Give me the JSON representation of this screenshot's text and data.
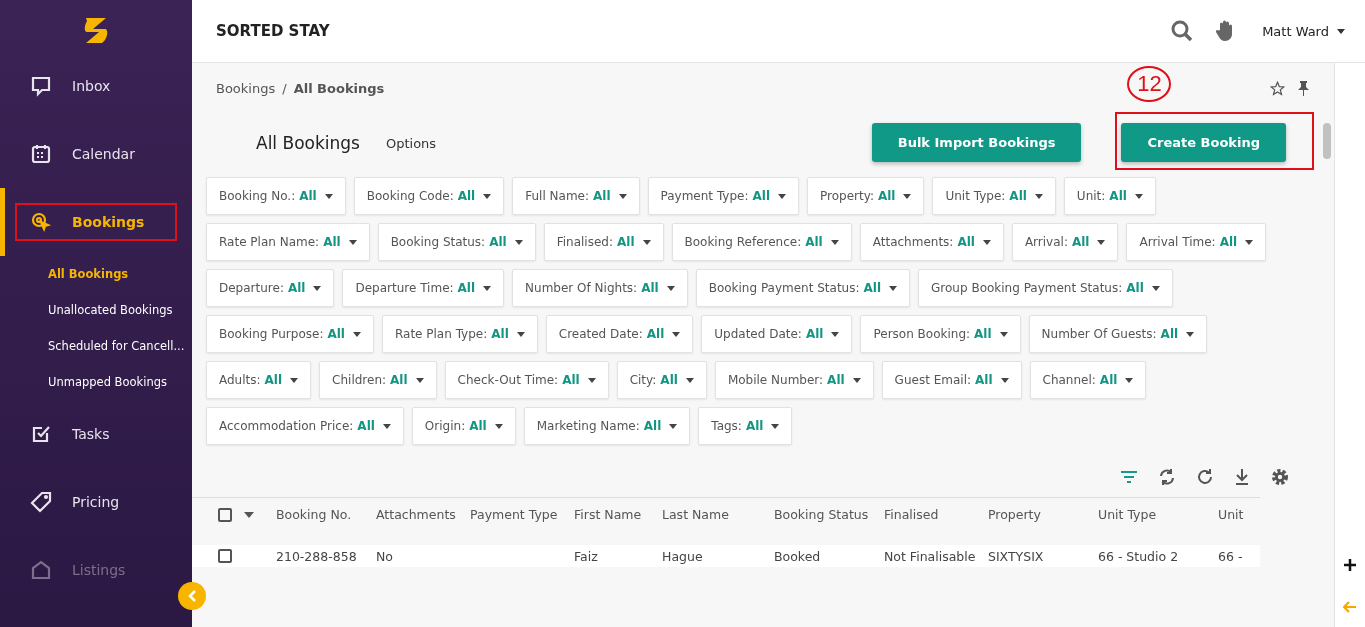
{
  "sidebar": {
    "items": [
      {
        "label": "Inbox",
        "kind": "inbox",
        "selected": false,
        "disabled": false,
        "highlighted": false
      },
      {
        "label": "Calendar",
        "kind": "calendar",
        "selected": false,
        "disabled": false,
        "highlighted": false
      },
      {
        "label": "Bookings",
        "kind": "bookings",
        "selected": true,
        "disabled": false,
        "highlighted": true,
        "children": [
          {
            "label": "All Bookings",
            "selected": true
          },
          {
            "label": "Unallocated Bookings",
            "selected": false
          },
          {
            "label": "Scheduled for Cancell...",
            "selected": false
          },
          {
            "label": "Unmapped Bookings",
            "selected": false
          }
        ]
      },
      {
        "label": "Tasks",
        "kind": "tasks",
        "selected": false,
        "disabled": false,
        "highlighted": false
      },
      {
        "label": "Pricing",
        "kind": "pricing",
        "selected": false,
        "disabled": false,
        "highlighted": false
      },
      {
        "label": "Listings",
        "kind": "listings",
        "selected": false,
        "disabled": true,
        "highlighted": false
      }
    ]
  },
  "header": {
    "title": "SORTED STAY",
    "user": "Matt Ward"
  },
  "breadcrumb": {
    "separator": "/",
    "items": [
      "Bookings",
      "All Bookings"
    ]
  },
  "page": {
    "title": "All Bookings",
    "options": "Options",
    "annotation": "12",
    "buttons": [
      {
        "label": "Bulk Import Bookings",
        "highlighted": false
      },
      {
        "label": "Create Booking",
        "highlighted": true
      }
    ]
  },
  "filters": [
    {
      "label": "Booking No.:",
      "value": "All"
    },
    {
      "label": "Booking Code:",
      "value": "All"
    },
    {
      "label": "Full Name:",
      "value": "All"
    },
    {
      "label": "Payment Type:",
      "value": "All"
    },
    {
      "label": "Property:",
      "value": "All"
    },
    {
      "label": "Unit Type:",
      "value": "All"
    },
    {
      "label": "Unit:",
      "value": "All"
    },
    {
      "label": "Rate Plan Name:",
      "value": "All"
    },
    {
      "label": "Booking Status:",
      "value": "All"
    },
    {
      "label": "Finalised:",
      "value": "All"
    },
    {
      "label": "Booking Reference:",
      "value": "All"
    },
    {
      "label": "Attachments:",
      "value": "All"
    },
    {
      "label": "Arrival:",
      "value": "All"
    },
    {
      "label": "Arrival Time:",
      "value": "All"
    },
    {
      "label": "Departure:",
      "value": "All"
    },
    {
      "label": "Departure Time:",
      "value": "All"
    },
    {
      "label": "Number Of Nights:",
      "value": "All"
    },
    {
      "label": "Booking Payment Status:",
      "value": "All"
    },
    {
      "label": "Group Booking Payment Status:",
      "value": "All"
    },
    {
      "label": "Booking Purpose:",
      "value": "All"
    },
    {
      "label": "Rate Plan Type:",
      "value": "All"
    },
    {
      "label": "Created Date:",
      "value": "All"
    },
    {
      "label": "Updated Date:",
      "value": "All"
    },
    {
      "label": "Person Booking:",
      "value": "All"
    },
    {
      "label": "Number Of Guests:",
      "value": "All"
    },
    {
      "label": "Adults:",
      "value": "All"
    },
    {
      "label": "Children:",
      "value": "All"
    },
    {
      "label": "Check-Out Time:",
      "value": "All"
    },
    {
      "label": "City:",
      "value": "All"
    },
    {
      "label": "Mobile Number:",
      "value": "All"
    },
    {
      "label": "Guest Email:",
      "value": "All"
    },
    {
      "label": "Channel:",
      "value": "All"
    },
    {
      "label": "Accommodation Price:",
      "value": "All"
    },
    {
      "label": "Origin:",
      "value": "All"
    },
    {
      "label": "Marketing Name:",
      "value": "All"
    },
    {
      "label": "Tags:",
      "value": "All"
    }
  ],
  "table": {
    "select_all_checked": false,
    "columns": [
      "Booking No.",
      "Attachments",
      "Payment Type",
      "First Name",
      "Last Name",
      "Booking Status",
      "Finalised",
      "Property",
      "Unit Type",
      "Unit"
    ],
    "rows": [
      {
        "checked": false,
        "cells": [
          "210-288-858",
          "No",
          "",
          "Faiz",
          "Hague",
          "Booked",
          "Not Finalisable",
          "SIXTYSIX",
          "66 - Studio 2",
          "66 -"
        ]
      }
    ]
  }
}
